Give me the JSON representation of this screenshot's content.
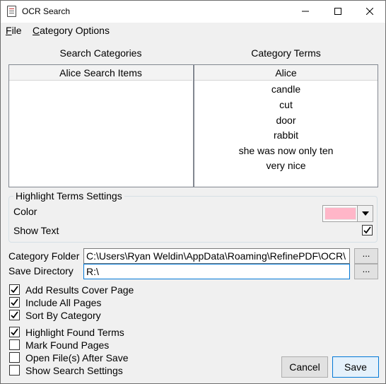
{
  "window": {
    "title": "OCR Search"
  },
  "menu": {
    "file": "File",
    "file_u": "F",
    "file_rest": "ile",
    "category_u": "C",
    "category_rest": "ategory Options"
  },
  "categories": {
    "title": "Search Categories",
    "header": "Alice Search Items",
    "items": []
  },
  "terms": {
    "title": "Category Terms",
    "header": "Alice",
    "items": [
      "candle",
      "cut",
      "door",
      "rabbit",
      "she was now only ten",
      "very nice"
    ]
  },
  "highlight": {
    "title": "Highlight Terms Settings",
    "color_label": "Color",
    "color_value": "#ffb6c8",
    "show_text_label": "Show Text",
    "show_text_checked": true
  },
  "folders": {
    "category_label": "Category Folder",
    "category_value": "C:\\Users\\Ryan Weldin\\AppData\\Roaming\\RefinePDF\\OCR\\",
    "save_label": "Save Directory",
    "save_value": "R:\\",
    "browse_label": "..."
  },
  "options": [
    {
      "label": "Add Results Cover Page",
      "checked": true
    },
    {
      "label": "Include All Pages",
      "checked": true
    },
    {
      "label": "Sort By Category",
      "checked": true
    },
    {
      "label": "Highlight Found Terms",
      "checked": true
    },
    {
      "label": "Mark Found Pages",
      "checked": false
    },
    {
      "label": "Open File(s) After Save",
      "checked": false
    },
    {
      "label": "Show Search Settings",
      "checked": false
    }
  ],
  "buttons": {
    "cancel": "Cancel",
    "save": "Save"
  }
}
